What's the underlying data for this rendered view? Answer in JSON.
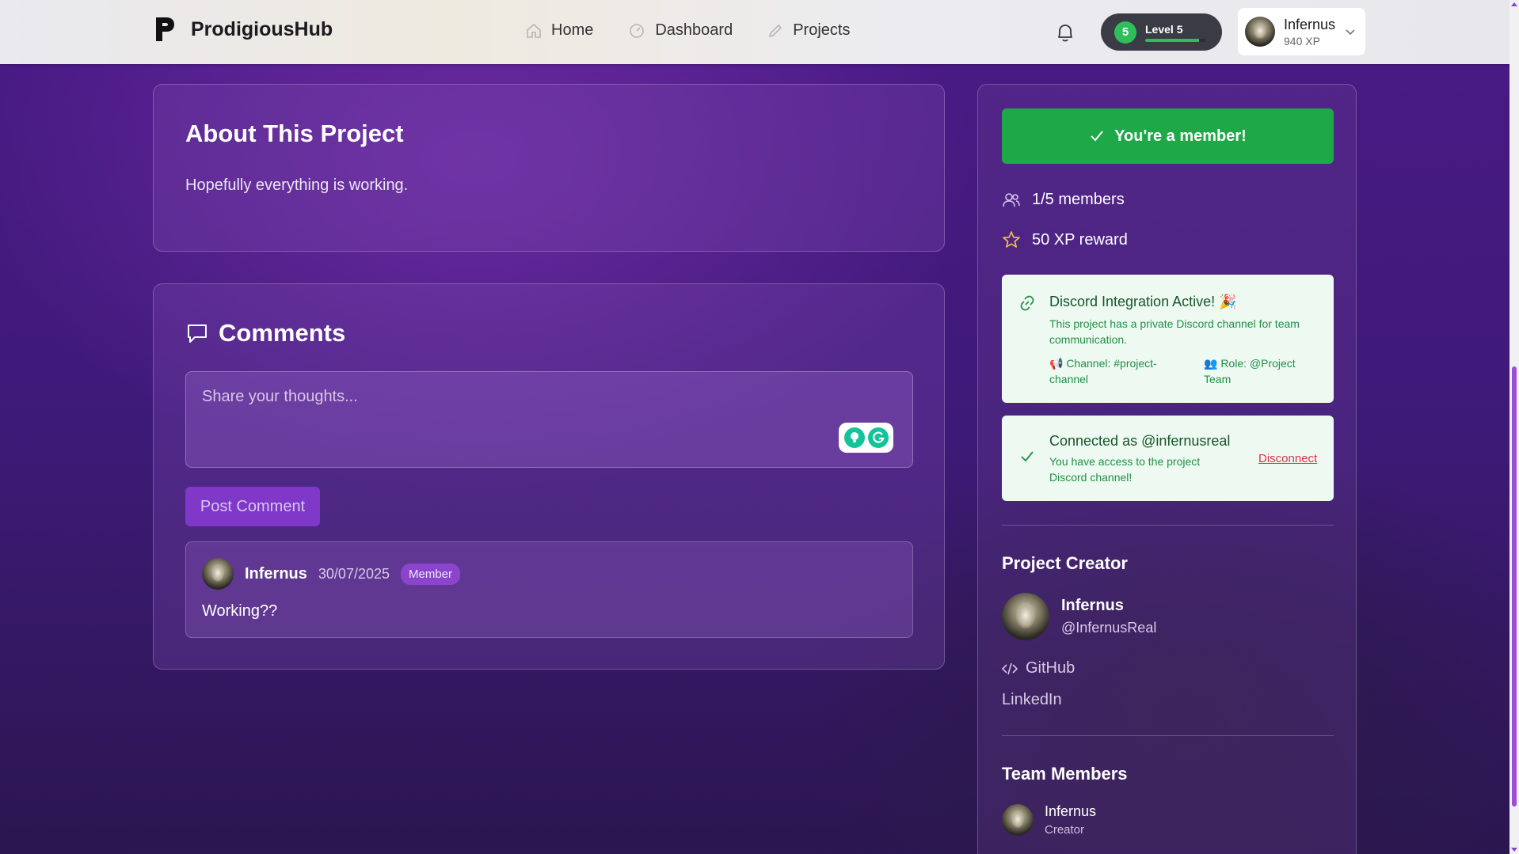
{
  "nav": {
    "brand": "ProdigiousHub",
    "links": [
      {
        "label": "Home",
        "icon": "home-icon"
      },
      {
        "label": "Dashboard",
        "icon": "dashboard-icon"
      },
      {
        "label": "Projects",
        "icon": "pencil-icon"
      }
    ],
    "level": {
      "number": "5",
      "label": "Level 5",
      "progress": 0.9
    },
    "user": {
      "name": "Infernus",
      "xp": "940 XP"
    }
  },
  "about": {
    "title": "About This Project",
    "description": "Hopefully everything is working."
  },
  "comments": {
    "title": "Comments",
    "placeholder": "Share your thoughts...",
    "post_label": "Post Comment",
    "items": [
      {
        "author": "Infernus",
        "date": "30/07/2025",
        "badge": "Member",
        "text": "Working??"
      }
    ]
  },
  "sidebar": {
    "member_label": "You're a member!",
    "members": "1/5 members",
    "reward": "50 XP reward",
    "discord": {
      "title": "Discord Integration Active! 🎉",
      "description": "This project has a private Discord channel for team communication.",
      "channel": "📢 Channel: #project-channel",
      "role": "👥 Role: @Project Team"
    },
    "connection": {
      "title": "Connected as @infernusreal",
      "description": "You have access to the project Discord channel!",
      "disconnect": "Disconnect"
    },
    "creator_heading": "Project Creator",
    "creator": {
      "name": "Infernus",
      "handle": "@InfernusReal"
    },
    "links": {
      "github": "GitHub",
      "linkedin": "LinkedIn"
    },
    "team_heading": "Team Members",
    "team": [
      {
        "name": "Infernus",
        "role": "Creator"
      }
    ]
  },
  "colors": {
    "accent": "#7f38c8",
    "success": "#1ea847",
    "danger": "#d8344b"
  }
}
